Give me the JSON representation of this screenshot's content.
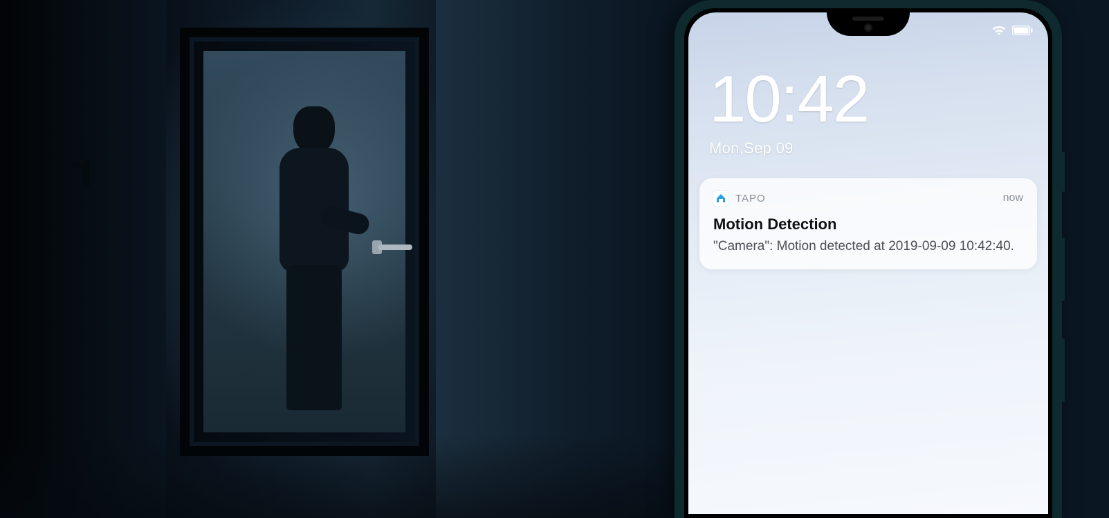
{
  "lockscreen": {
    "time": "10:42",
    "date": "Mon,Sep 09"
  },
  "notification": {
    "app_name": "TAPO",
    "when": "now",
    "title": "Motion Detection",
    "body": "\"Camera\":  Motion detected at 2019-09-09  10:42:40."
  }
}
